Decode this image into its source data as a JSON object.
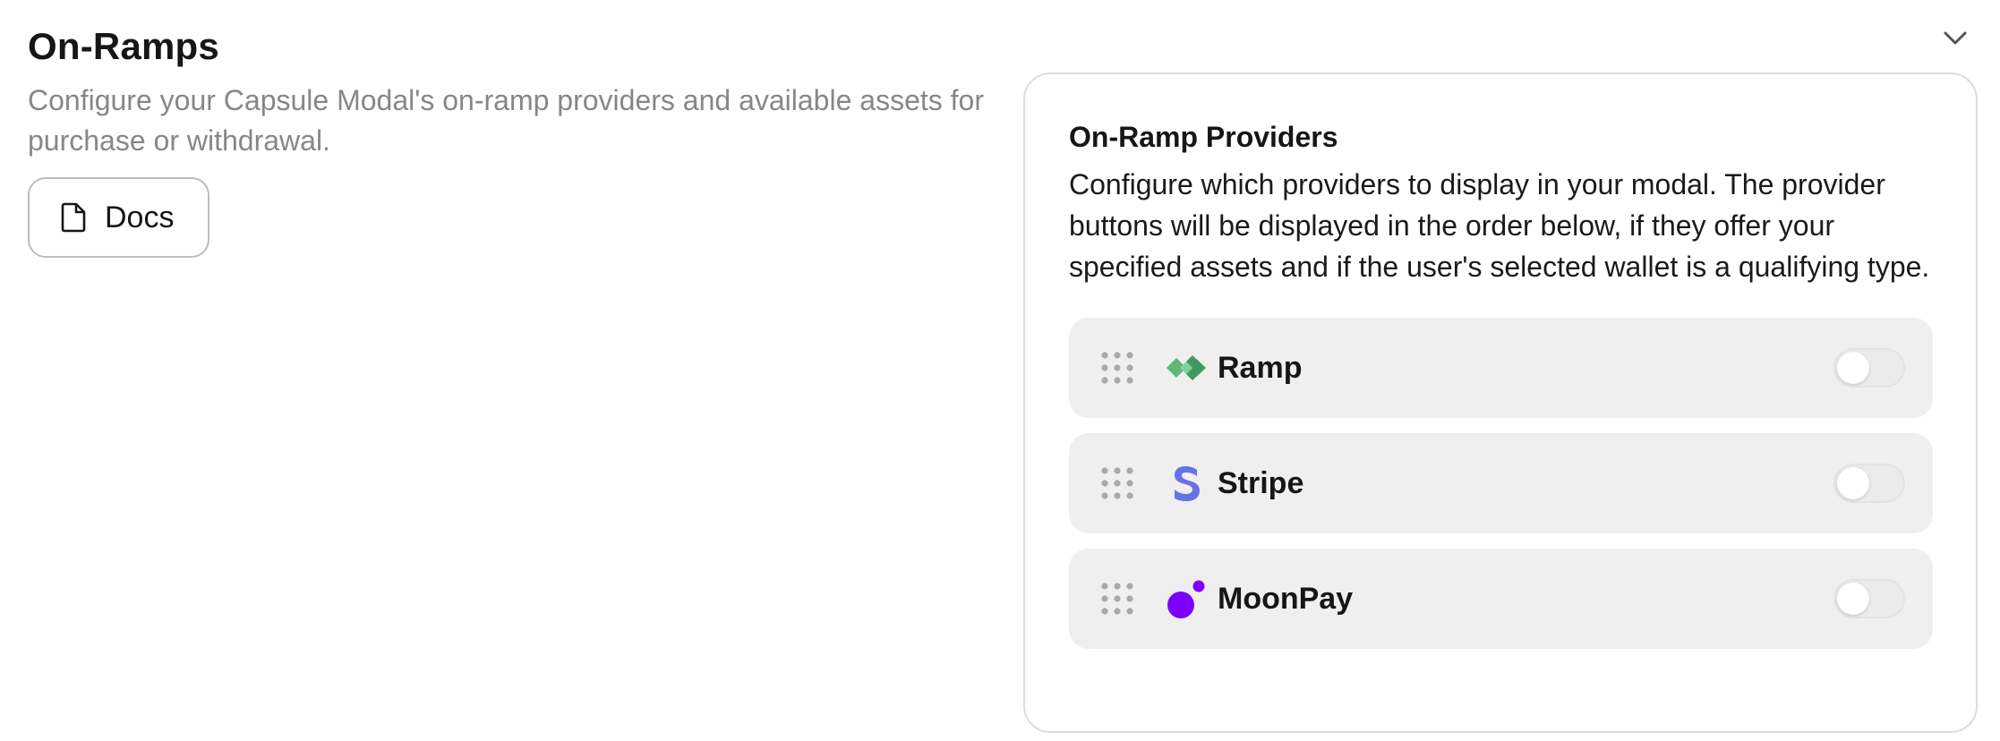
{
  "section": {
    "title": "On-Ramps",
    "description": "Configure your Capsule Modal's on-ramp providers and available assets for purchase or withdrawal.",
    "docs_label": "Docs"
  },
  "card": {
    "title": "On-Ramp Providers",
    "description": "Configure which providers to display in your modal. The provider buttons will be displayed in the order below, if they offer your specified assets and if the user's selected wallet is a qualifying type."
  },
  "providers": [
    {
      "name": "Ramp",
      "logo": "ramp-logo-icon",
      "enabled": false
    },
    {
      "name": "Stripe",
      "logo": "stripe-logo-icon",
      "enabled": false
    },
    {
      "name": "MoonPay",
      "logo": "moonpay-logo-icon",
      "enabled": false
    }
  ],
  "colors": {
    "ramp": "#5fb878",
    "stripe": "#6772e5",
    "moonpay": "#7d00ff",
    "muted_text": "#878787",
    "row_bg": "#efefef"
  }
}
